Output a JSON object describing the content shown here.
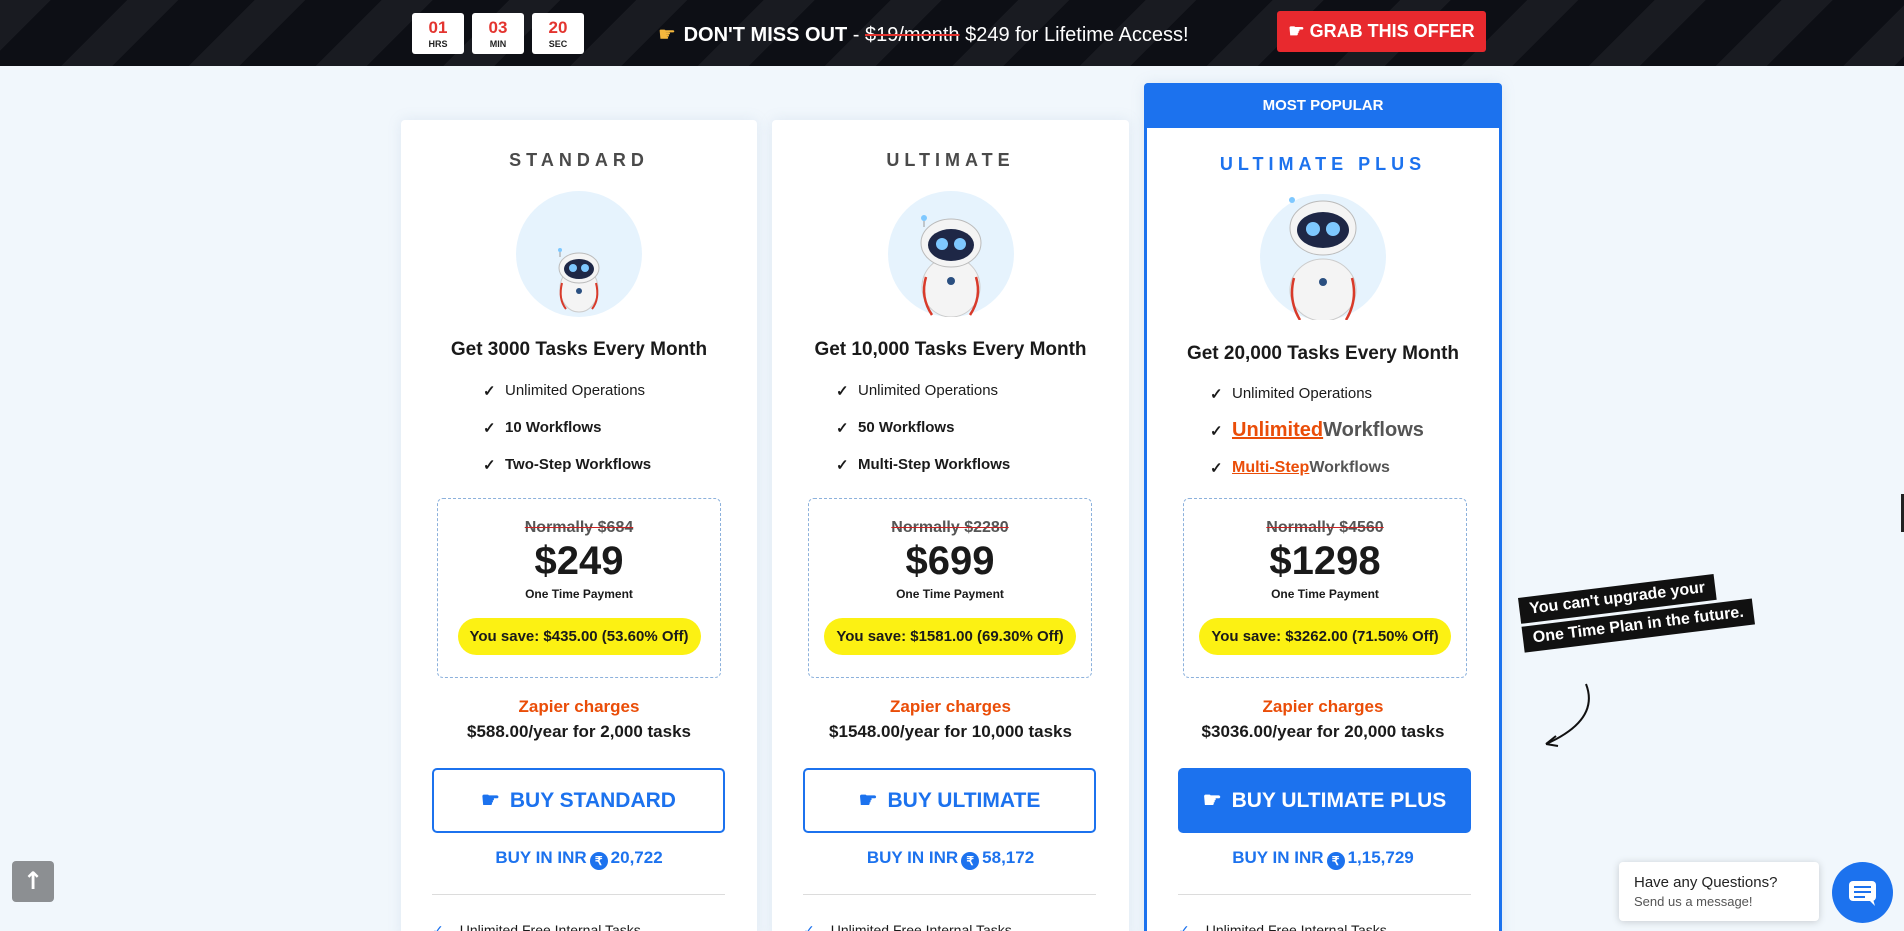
{
  "topbar": {
    "timer": [
      {
        "value": "01",
        "label": "HRS"
      },
      {
        "value": "03",
        "label": "MIN"
      },
      {
        "value": "20",
        "label": "SEC"
      }
    ],
    "promo_icon": "pointing-hand-icon",
    "promo_bold": "DON'T MISS OUT",
    "promo_sep": " - ",
    "promo_old": "$19/month",
    "promo_rest": " $249 for Lifetime Access!",
    "offer_button": "GRAB THIS OFFER",
    "offer_icon": "pointing-hand-icon"
  },
  "plans": [
    {
      "name": "STANDARD",
      "tasks": "Get 3000 Tasks Every Month",
      "features": [
        "Unlimited Operations",
        "10 Workflows",
        "Two-Step Workflows"
      ],
      "normally": "Normally $684",
      "price": "$249",
      "payment": "One Time Payment",
      "save": "You save: $435.00 (53.60% Off)",
      "zapier_label": "Zapier charges",
      "zapier_value": "$588.00/year for 2,000 tasks",
      "buy": "BUY STANDARD",
      "inr_label": "BUY IN INR",
      "inr_symbol": "₹",
      "inr_value": "20,722",
      "extra_feature": "Unlimited Free Internal Tasks"
    },
    {
      "name": "ULTIMATE",
      "tasks": "Get 10,000 Tasks Every Month",
      "features": [
        "Unlimited Operations",
        "50 Workflows",
        "Multi-Step Workflows"
      ],
      "normally": "Normally $2280",
      "price": "$699",
      "payment": "One Time Payment",
      "save": "You save: $1581.00 (69.30% Off)",
      "zapier_label": "Zapier charges",
      "zapier_value": "$1548.00/year for 10,000 tasks",
      "buy": "BUY ULTIMATE",
      "inr_label": "BUY IN INR",
      "inr_symbol": "₹",
      "inr_value": "58,172",
      "extra_feature": "Unlimited Free Internal Tasks"
    },
    {
      "badge": "MOST POPULAR",
      "name": "ULTIMATE PLUS",
      "tasks": "Get 20,000 Tasks Every Month",
      "features": [
        "Unlimited Operations"
      ],
      "feature2_highlight": "Unlimited",
      "feature2_rest": " Workflows",
      "feature3_highlight": "Multi-Step",
      "feature3_rest": " Workflows",
      "normally": "Normally $4560",
      "price": "$1298",
      "payment": "One Time Payment",
      "save": "You save: $3262.00 (71.50% Off)",
      "zapier_label": "Zapier charges",
      "zapier_value": "$3036.00/year for 20,000 tasks",
      "buy": "BUY ULTIMATE PLUS",
      "inr_label": "BUY IN INR",
      "inr_symbol": "₹",
      "inr_value": "1,15,729",
      "extra_feature": "Unlimited Free Internal Tasks"
    }
  ],
  "note": {
    "line1": "You can't upgrade your",
    "line2": "One Time Plan in the future."
  },
  "chat": {
    "question": "Have any Questions?",
    "sub": "Send us a message!"
  },
  "icons": {
    "check": "check-icon",
    "robot": "robot-icon",
    "scroll_top": "arrow-up-icon",
    "chat": "chat-bubble-icon"
  },
  "colors": {
    "accent": "#1c72ee",
    "alert": "#e8292e",
    "highlight": "#fcf113",
    "orange": "#ea4d08"
  }
}
